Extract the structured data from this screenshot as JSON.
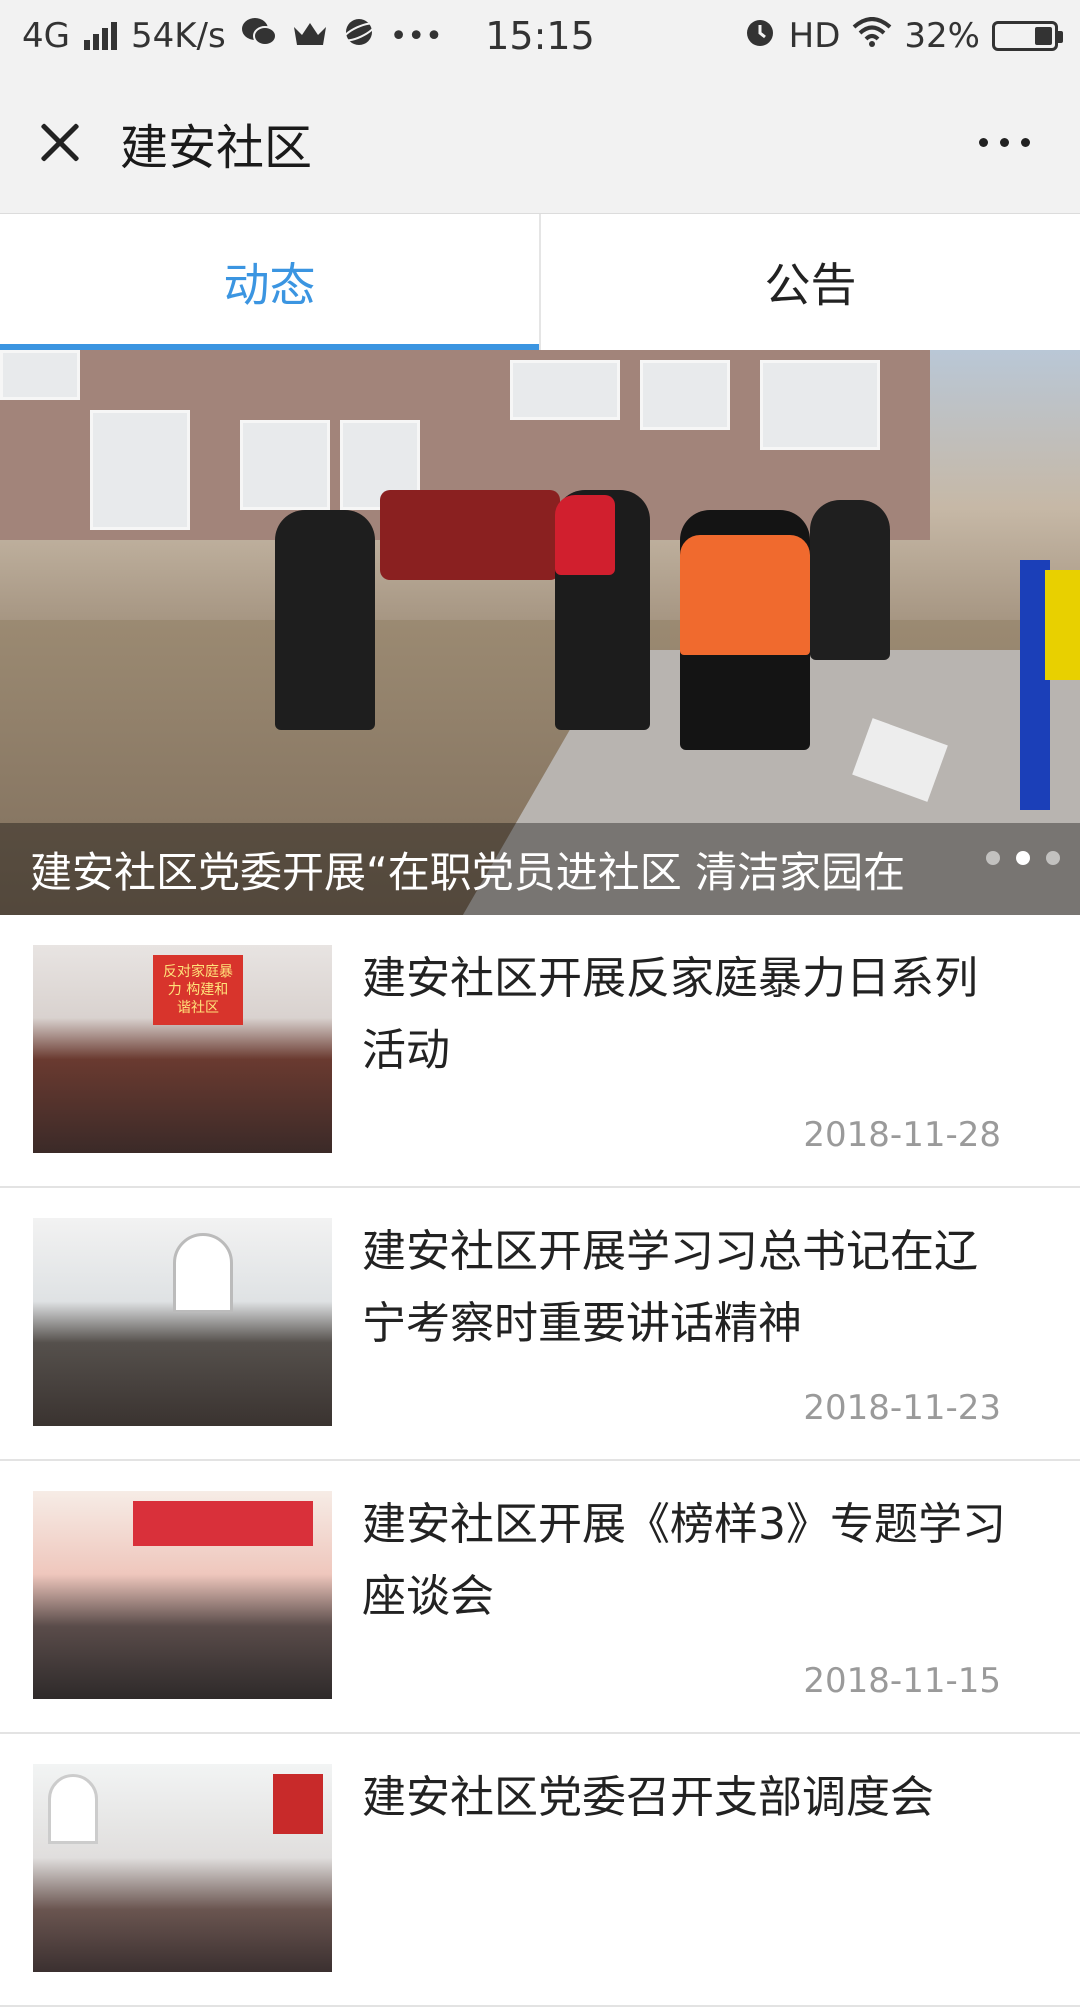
{
  "status_bar": {
    "network": "4G",
    "speed": "54K/s",
    "time": "15:15",
    "hd": "HD",
    "battery": "32%",
    "battery_level": 0.32,
    "icons": [
      "signal-icon",
      "wechat-icon",
      "crown-icon",
      "planet-icon",
      "more-dots-icon",
      "alarm-icon",
      "wifi-icon",
      "battery-icon"
    ]
  },
  "nav": {
    "title": "建安社区",
    "close_icon": "close-icon",
    "more_icon": "more-icon"
  },
  "tabs": [
    {
      "label": "动态",
      "active": true
    },
    {
      "label": "公告",
      "active": false
    }
  ],
  "banner": {
    "caption": "建安社区党委开展“在职党员进社区 清洁家园在",
    "slide_count": 3,
    "active_slide": 1
  },
  "articles": [
    {
      "title": "建安社区开展反家庭暴力日系列活动",
      "date": "2018-11-28",
      "thumb_text": "反对家庭暴力 构建和谐社区"
    },
    {
      "title": "建安社区开展学习习总书记在辽宁考察时重要讲话精神",
      "date": "2018-11-23"
    },
    {
      "title": "建安社区开展《榜样3》专题学习座谈会",
      "date": "2018-11-15"
    },
    {
      "title": "建安社区党委召开支部调度会",
      "date": ""
    }
  ],
  "colors": {
    "accent": "#3b95e1",
    "bar_bg": "#f2f2f2",
    "date": "#9a9a9a"
  }
}
